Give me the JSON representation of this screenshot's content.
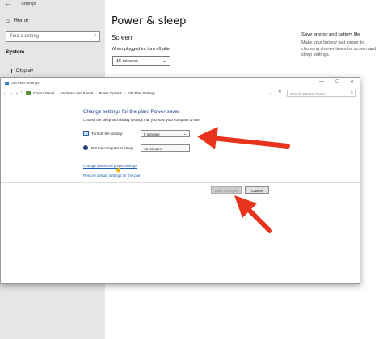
{
  "settings": {
    "title": "Settings",
    "home_label": "Home",
    "search_placeholder": "Find a setting",
    "section_heading": "System",
    "display_label": "Display",
    "page_title": "Power & sleep",
    "screen_heading": "Screen",
    "plugged_in_label": "When plugged in, turn off after",
    "plugged_in_value": "15 minutes",
    "side_heading": "Save energy and battery life",
    "side_text": "Make your battery last longer by choosing shorter times for screen and sleep settings."
  },
  "edit_plan": {
    "title": "Edit Plan Settings",
    "breadcrumb": [
      "Control Panel",
      "Hardware and Sound",
      "Power Options",
      "Edit Plan Settings"
    ],
    "search_placeholder": "Search Control Panel",
    "heading": "Change settings for the plan: Power saver",
    "subheading": "Choose the sleep and display settings that you want your computer to use.",
    "display_label": "Turn off the display:",
    "display_value": "5 minutes",
    "sleep_label": "Put the computer to sleep:",
    "sleep_value": "15 minutes",
    "advanced_link": "Change advanced power settings",
    "restore_link": "Restore default settings for this plan",
    "save_button": "Save changes",
    "cancel_button": "Cancel"
  },
  "icons": {
    "back": "back-arrow-icon",
    "home": "home-icon",
    "search": "search-icon",
    "display": "display-icon",
    "monitor": "monitor-icon",
    "sleep": "moon-icon",
    "cursor": "mouse-cursor-icon"
  },
  "colors": {
    "annotation_arrow": "#e8341c",
    "link": "#1a5fb4",
    "heading": "#1e3f8a"
  }
}
